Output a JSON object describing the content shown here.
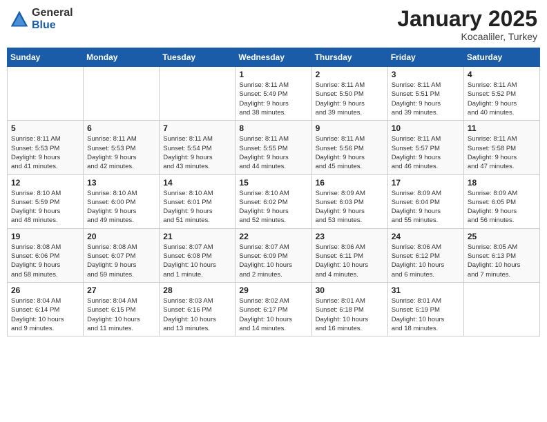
{
  "logo": {
    "general": "General",
    "blue": "Blue"
  },
  "title": "January 2025",
  "location": "Kocaaliler, Turkey",
  "weekdays": [
    "Sunday",
    "Monday",
    "Tuesday",
    "Wednesday",
    "Thursday",
    "Friday",
    "Saturday"
  ],
  "weeks": [
    [
      {
        "day": "",
        "info": ""
      },
      {
        "day": "",
        "info": ""
      },
      {
        "day": "",
        "info": ""
      },
      {
        "day": "1",
        "info": "Sunrise: 8:11 AM\nSunset: 5:49 PM\nDaylight: 9 hours\nand 38 minutes."
      },
      {
        "day": "2",
        "info": "Sunrise: 8:11 AM\nSunset: 5:50 PM\nDaylight: 9 hours\nand 39 minutes."
      },
      {
        "day": "3",
        "info": "Sunrise: 8:11 AM\nSunset: 5:51 PM\nDaylight: 9 hours\nand 39 minutes."
      },
      {
        "day": "4",
        "info": "Sunrise: 8:11 AM\nSunset: 5:52 PM\nDaylight: 9 hours\nand 40 minutes."
      }
    ],
    [
      {
        "day": "5",
        "info": "Sunrise: 8:11 AM\nSunset: 5:53 PM\nDaylight: 9 hours\nand 41 minutes."
      },
      {
        "day": "6",
        "info": "Sunrise: 8:11 AM\nSunset: 5:53 PM\nDaylight: 9 hours\nand 42 minutes."
      },
      {
        "day": "7",
        "info": "Sunrise: 8:11 AM\nSunset: 5:54 PM\nDaylight: 9 hours\nand 43 minutes."
      },
      {
        "day": "8",
        "info": "Sunrise: 8:11 AM\nSunset: 5:55 PM\nDaylight: 9 hours\nand 44 minutes."
      },
      {
        "day": "9",
        "info": "Sunrise: 8:11 AM\nSunset: 5:56 PM\nDaylight: 9 hours\nand 45 minutes."
      },
      {
        "day": "10",
        "info": "Sunrise: 8:11 AM\nSunset: 5:57 PM\nDaylight: 9 hours\nand 46 minutes."
      },
      {
        "day": "11",
        "info": "Sunrise: 8:11 AM\nSunset: 5:58 PM\nDaylight: 9 hours\nand 47 minutes."
      }
    ],
    [
      {
        "day": "12",
        "info": "Sunrise: 8:10 AM\nSunset: 5:59 PM\nDaylight: 9 hours\nand 48 minutes."
      },
      {
        "day": "13",
        "info": "Sunrise: 8:10 AM\nSunset: 6:00 PM\nDaylight: 9 hours\nand 49 minutes."
      },
      {
        "day": "14",
        "info": "Sunrise: 8:10 AM\nSunset: 6:01 PM\nDaylight: 9 hours\nand 51 minutes."
      },
      {
        "day": "15",
        "info": "Sunrise: 8:10 AM\nSunset: 6:02 PM\nDaylight: 9 hours\nand 52 minutes."
      },
      {
        "day": "16",
        "info": "Sunrise: 8:09 AM\nSunset: 6:03 PM\nDaylight: 9 hours\nand 53 minutes."
      },
      {
        "day": "17",
        "info": "Sunrise: 8:09 AM\nSunset: 6:04 PM\nDaylight: 9 hours\nand 55 minutes."
      },
      {
        "day": "18",
        "info": "Sunrise: 8:09 AM\nSunset: 6:05 PM\nDaylight: 9 hours\nand 56 minutes."
      }
    ],
    [
      {
        "day": "19",
        "info": "Sunrise: 8:08 AM\nSunset: 6:06 PM\nDaylight: 9 hours\nand 58 minutes."
      },
      {
        "day": "20",
        "info": "Sunrise: 8:08 AM\nSunset: 6:07 PM\nDaylight: 9 hours\nand 59 minutes."
      },
      {
        "day": "21",
        "info": "Sunrise: 8:07 AM\nSunset: 6:08 PM\nDaylight: 10 hours\nand 1 minute."
      },
      {
        "day": "22",
        "info": "Sunrise: 8:07 AM\nSunset: 6:09 PM\nDaylight: 10 hours\nand 2 minutes."
      },
      {
        "day": "23",
        "info": "Sunrise: 8:06 AM\nSunset: 6:11 PM\nDaylight: 10 hours\nand 4 minutes."
      },
      {
        "day": "24",
        "info": "Sunrise: 8:06 AM\nSunset: 6:12 PM\nDaylight: 10 hours\nand 6 minutes."
      },
      {
        "day": "25",
        "info": "Sunrise: 8:05 AM\nSunset: 6:13 PM\nDaylight: 10 hours\nand 7 minutes."
      }
    ],
    [
      {
        "day": "26",
        "info": "Sunrise: 8:04 AM\nSunset: 6:14 PM\nDaylight: 10 hours\nand 9 minutes."
      },
      {
        "day": "27",
        "info": "Sunrise: 8:04 AM\nSunset: 6:15 PM\nDaylight: 10 hours\nand 11 minutes."
      },
      {
        "day": "28",
        "info": "Sunrise: 8:03 AM\nSunset: 6:16 PM\nDaylight: 10 hours\nand 13 minutes."
      },
      {
        "day": "29",
        "info": "Sunrise: 8:02 AM\nSunset: 6:17 PM\nDaylight: 10 hours\nand 14 minutes."
      },
      {
        "day": "30",
        "info": "Sunrise: 8:01 AM\nSunset: 6:18 PM\nDaylight: 10 hours\nand 16 minutes."
      },
      {
        "day": "31",
        "info": "Sunrise: 8:01 AM\nSunset: 6:19 PM\nDaylight: 10 hours\nand 18 minutes."
      },
      {
        "day": "",
        "info": ""
      }
    ]
  ]
}
